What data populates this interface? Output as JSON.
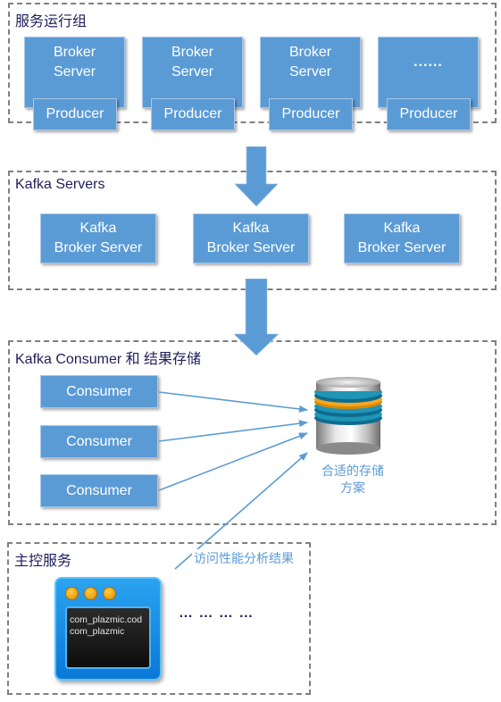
{
  "groups": {
    "service": {
      "title": "服务运行组"
    },
    "kafka_servers": {
      "title": "Kafka Servers"
    },
    "consumer_storage": {
      "title": "Kafka Consumer 和 结果存储"
    },
    "master": {
      "title": "主控服务"
    }
  },
  "brokers": [
    {
      "line1": "Broker",
      "line2": "Server",
      "producer": "Producer"
    },
    {
      "line1": "Broker",
      "line2": "Server",
      "producer": "Producer"
    },
    {
      "line1": "Broker",
      "line2": "Server",
      "producer": "Producer"
    },
    {
      "line1": "......",
      "line2": "",
      "producer": "Producer"
    }
  ],
  "kafka_brokers": [
    {
      "line1": "Kafka",
      "line2": "Broker Server"
    },
    {
      "line1": "Kafka",
      "line2": "Broker Server"
    },
    {
      "line1": "Kafka",
      "line2": "Broker Server"
    }
  ],
  "consumers": [
    "Consumer",
    "Consumer",
    "Consumer"
  ],
  "storage": {
    "icon": "database-icon",
    "line1": "合适的存储",
    "line2": "方案"
  },
  "access_label": "访问性能分析结果",
  "terminal": {
    "icon": "terminal-window-icon",
    "lines": [
      "com_plazmic.cod",
      "com_plazmic"
    ]
  },
  "ellipsis": "… … … …",
  "colors": {
    "box": "#5b9bd5",
    "arrow": "#5b9bd5",
    "border": "#808080",
    "title": "#1f1f5a"
  }
}
